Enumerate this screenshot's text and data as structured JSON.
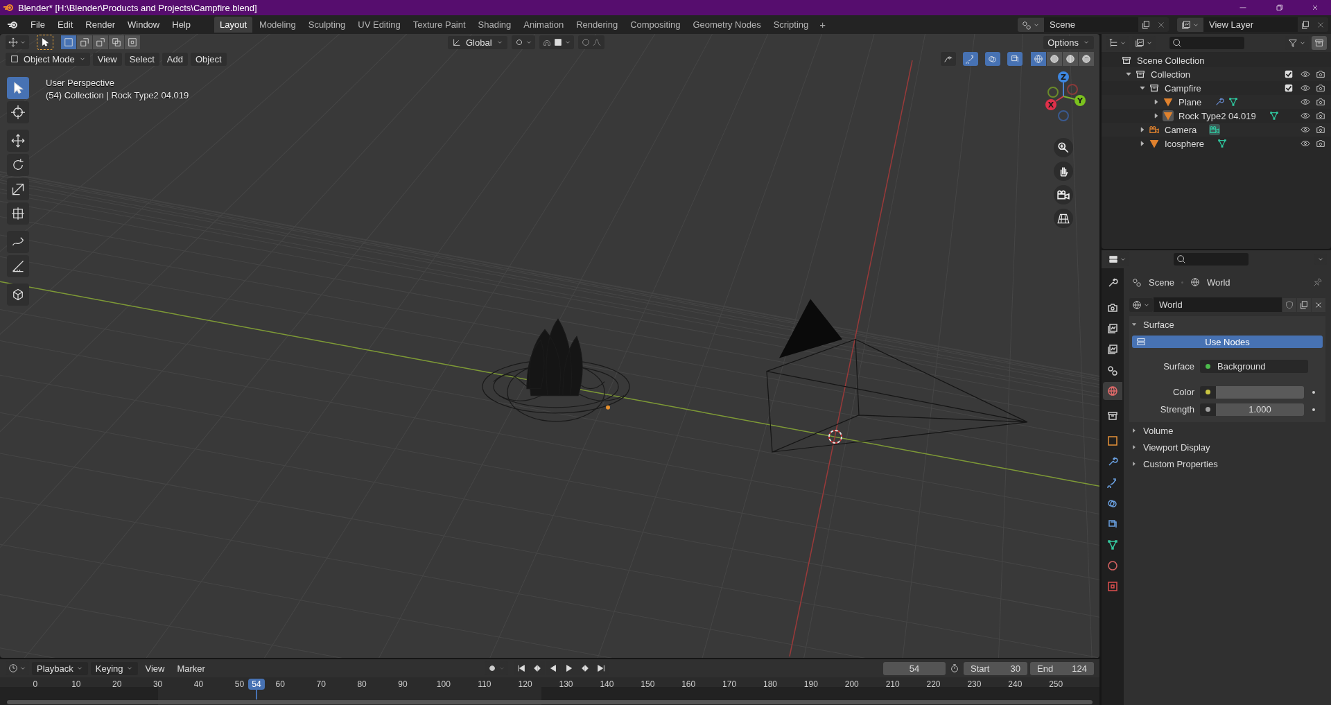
{
  "window": {
    "title": "Blender* [H:\\Blender\\Products and Projects\\Campfire.blend]"
  },
  "menu": [
    "File",
    "Edit",
    "Render",
    "Window",
    "Help"
  ],
  "workspace_tabs": [
    {
      "label": "Layout",
      "selected": true
    },
    {
      "label": "Modeling",
      "selected": false
    },
    {
      "label": "Sculpting",
      "selected": false
    },
    {
      "label": "UV Editing",
      "selected": false
    },
    {
      "label": "Texture Paint",
      "selected": false
    },
    {
      "label": "Shading",
      "selected": false
    },
    {
      "label": "Animation",
      "selected": false
    },
    {
      "label": "Rendering",
      "selected": false
    },
    {
      "label": "Compositing",
      "selected": false
    },
    {
      "label": "Geometry Nodes",
      "selected": false
    },
    {
      "label": "Scripting",
      "selected": false
    }
  ],
  "add_workspace": "+",
  "scene": "Scene",
  "view_layer": "View Layer",
  "tool_header": {
    "select_modes": [
      {
        "kind": "set",
        "selected": true
      },
      {
        "kind": "extend",
        "selected": false
      },
      {
        "kind": "subtract",
        "selected": false
      },
      {
        "kind": "invert",
        "selected": false
      },
      {
        "kind": "intersect",
        "selected": false
      }
    ],
    "orientation": "Global",
    "options": "Options"
  },
  "viewport_header": {
    "mode": "Object Mode",
    "menus": [
      "View",
      "Select",
      "Add",
      "Object"
    ],
    "toggles": [
      {
        "kind": "visibility",
        "on": false
      },
      {
        "kind": "gizmos",
        "on": true
      },
      {
        "kind": "overlays",
        "on": true
      },
      {
        "kind": "xray",
        "on": true
      }
    ],
    "shading_modes": [
      {
        "kind": "wireframe",
        "selected": true
      },
      {
        "kind": "solid",
        "selected": false
      },
      {
        "kind": "material",
        "selected": false
      },
      {
        "kind": "rendered",
        "selected": false
      }
    ]
  },
  "viewport": {
    "info": [
      "User Perspective",
      "(54) Collection | Rock Type2 04.019"
    ],
    "axes": [
      "X",
      "Y",
      "Z"
    ]
  },
  "toolbar": [
    {
      "kind": "select",
      "selected": true
    },
    {
      "kind": "cursor",
      "selected": false
    },
    {
      "kind": "move",
      "selected": false
    },
    {
      "kind": "rotate",
      "selected": false
    },
    {
      "kind": "scale",
      "selected": false
    },
    {
      "kind": "transform",
      "selected": false
    },
    {
      "kind": "annotate",
      "selected": false
    },
    {
      "kind": "measure",
      "selected": false
    },
    {
      "kind": "add-cube",
      "selected": false
    }
  ],
  "outliner": {
    "items": [
      {
        "label": "Scene Collection",
        "kind": "scene-collection",
        "children": [
          {
            "label": "Collection",
            "kind": "collection",
            "expanded": true,
            "checked": true,
            "children": [
              {
                "label": "Campfire",
                "kind": "collection",
                "expanded": true,
                "checked": true,
                "children": [
                  {
                    "label": "Plane",
                    "kind": "mesh",
                    "expanded": false,
                    "active": false,
                    "badges": [
                      {
                        "kind": "modifier"
                      },
                      {
                        "kind": "mesh-data"
                      }
                    ]
                  },
                  {
                    "label": "Rock Type2 04.019",
                    "kind": "mesh",
                    "expanded": false,
                    "active": true,
                    "badges": [
                      {
                        "kind": "mesh-data"
                      }
                    ]
                  }
                ]
              },
              {
                "label": "Camera",
                "kind": "camera",
                "expanded": false,
                "active": false,
                "badges": [
                  {
                    "kind": "camera-data"
                  }
                ]
              },
              {
                "label": "Icosphere",
                "kind": "mesh",
                "expanded": false,
                "active": false,
                "badges": [
                  {
                    "kind": "mesh-data"
                  }
                ]
              }
            ]
          }
        ]
      }
    ]
  },
  "properties": {
    "tabs": [
      {
        "kind": "tool",
        "selected": false
      },
      {
        "kind": "render",
        "selected": false
      },
      {
        "kind": "output",
        "selected": false
      },
      {
        "kind": "view-layer",
        "selected": false
      },
      {
        "kind": "scene",
        "selected": false
      },
      {
        "kind": "world",
        "selected": true
      },
      {
        "kind": "collection",
        "selected": false
      },
      {
        "kind": "object",
        "selected": false
      },
      {
        "kind": "modifiers",
        "selected": false
      },
      {
        "kind": "particles",
        "selected": false
      },
      {
        "kind": "physics",
        "selected": false
      },
      {
        "kind": "constraints",
        "selected": false
      },
      {
        "kind": "data",
        "selected": false
      },
      {
        "kind": "material",
        "selected": false
      },
      {
        "kind": "texture",
        "selected": false
      }
    ],
    "breadcrumb": [
      "Scene",
      "World"
    ],
    "world": "World",
    "panels": [
      {
        "label": "Surface",
        "expanded": true
      },
      {
        "label": "Volume",
        "expanded": false
      },
      {
        "label": "Viewport Display",
        "expanded": false
      },
      {
        "label": "Custom Properties",
        "expanded": false
      }
    ],
    "use_nodes": "Use Nodes",
    "fields": [
      {
        "label": "Surface",
        "kind": "shader",
        "value": "Background",
        "color": "#4cbb4c"
      },
      {
        "label": "Color",
        "kind": "color",
        "color": "#c9c441"
      },
      {
        "label": "Strength",
        "kind": "number",
        "value": "1.000",
        "color": "#a0a0a0"
      }
    ]
  },
  "timeline": {
    "menus": [
      "Playback",
      "Keying",
      "View",
      "Marker"
    ],
    "current_frame": "54",
    "start_label": "Start",
    "start": "30",
    "end_label": "End",
    "end": "124",
    "ruler": [
      "0",
      "10",
      "20",
      "30",
      "40",
      "50",
      "60",
      "70",
      "80",
      "90",
      "100",
      "110",
      "120",
      "130",
      "140",
      "150",
      "160",
      "170",
      "180",
      "190",
      "200",
      "210",
      "220",
      "230",
      "240",
      "250"
    ],
    "playhead": "54"
  }
}
